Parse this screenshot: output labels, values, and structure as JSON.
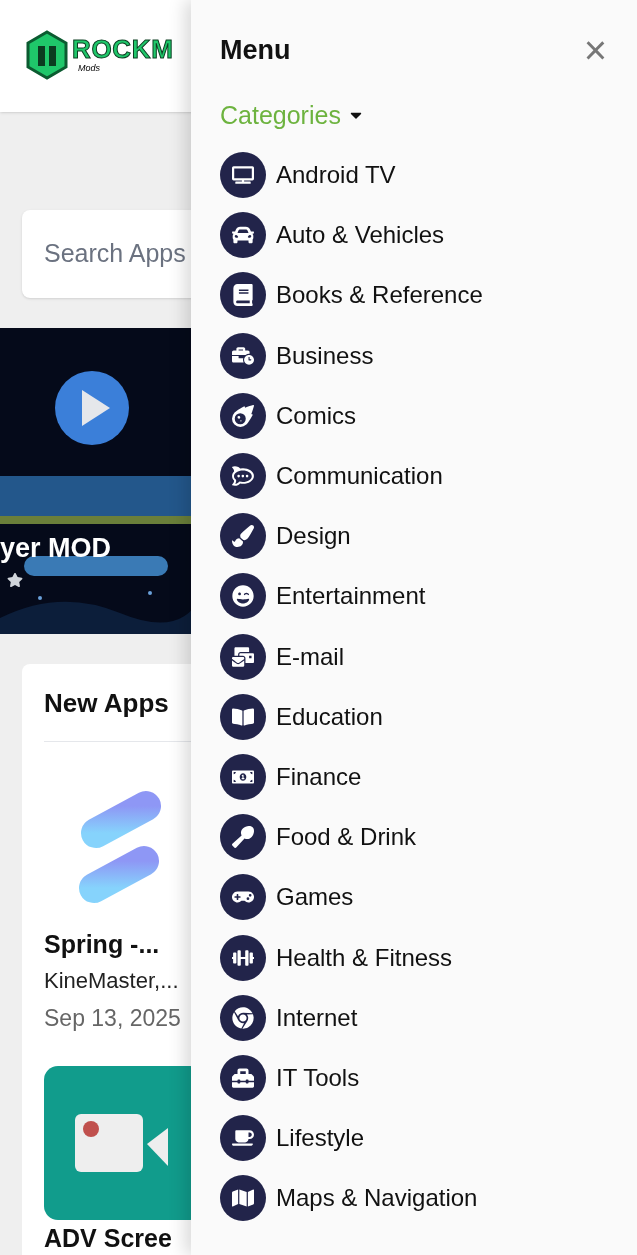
{
  "header": {
    "logo_text": "ROCKM",
    "logo_subtext": "Mods"
  },
  "search": {
    "placeholder": "Search Apps"
  },
  "banner": {
    "title": "yer MOD"
  },
  "new_apps": {
    "title": "New Apps",
    "apps": [
      {
        "name": "Spring -...",
        "developer": "KineMaster,...",
        "date": "Sep 13, 2025"
      },
      {
        "name": "ADV Scree"
      }
    ]
  },
  "menu": {
    "title": "Menu",
    "close": "×",
    "section": "Categories",
    "expanded": true,
    "items": [
      {
        "label": "Android TV"
      },
      {
        "label": "Auto & Vehicles"
      },
      {
        "label": "Books & Reference"
      },
      {
        "label": "Business"
      },
      {
        "label": "Comics"
      },
      {
        "label": "Communication"
      },
      {
        "label": "Design"
      },
      {
        "label": "Entertainment"
      },
      {
        "label": "E-mail"
      },
      {
        "label": "Education"
      },
      {
        "label": "Finance"
      },
      {
        "label": "Food & Drink"
      },
      {
        "label": "Games"
      },
      {
        "label": "Health & Fitness"
      },
      {
        "label": "Internet"
      },
      {
        "label": "IT Tools"
      },
      {
        "label": "Lifestyle"
      },
      {
        "label": "Maps & Navigation"
      }
    ]
  }
}
